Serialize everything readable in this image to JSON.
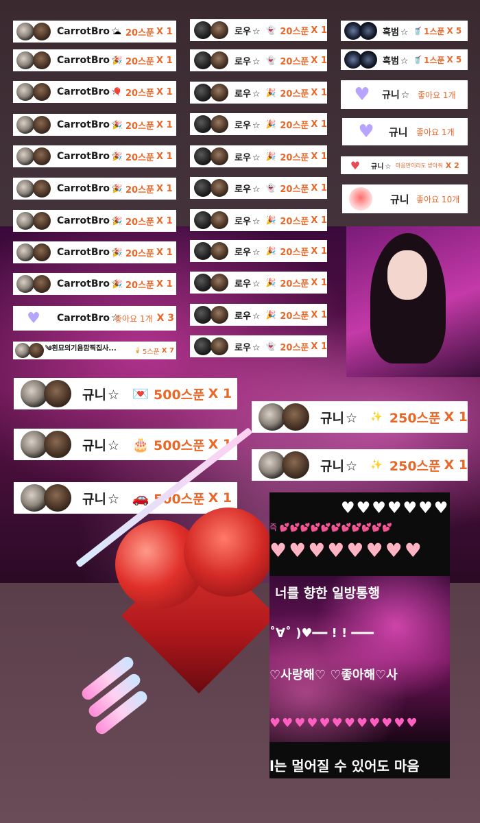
{
  "star": "☆",
  "carrot_cards": [
    {
      "name": "CarrotBro",
      "gift_icon": "cloud-icon",
      "gift_glyph": "☁",
      "amount": "20스푼",
      "multiplier": "X 1"
    },
    {
      "name": "CarrotBro",
      "gift_icon": "confetti-icon",
      "gift_glyph": "🎉",
      "amount": "20스푼",
      "multiplier": "X 1"
    },
    {
      "name": "CarrotBro",
      "gift_icon": "balloon-icon",
      "gift_glyph": "🎈",
      "amount": "20스푼",
      "multiplier": "X 1"
    },
    {
      "name": "CarrotBro",
      "gift_icon": "confetti-icon",
      "gift_glyph": "🎉",
      "amount": "20스푼",
      "multiplier": "X 1"
    },
    {
      "name": "CarrotBro",
      "gift_icon": "confetti-icon",
      "gift_glyph": "🎉",
      "amount": "20스푼",
      "multiplier": "X 1"
    },
    {
      "name": "CarrotBro",
      "gift_icon": "confetti-icon",
      "gift_glyph": "🎉",
      "amount": "20스푼",
      "multiplier": "X 1"
    },
    {
      "name": "CarrotBro",
      "gift_icon": "confetti-icon",
      "gift_glyph": "🎉",
      "amount": "20스푼",
      "multiplier": "X 1"
    },
    {
      "name": "CarrotBro",
      "gift_icon": "confetti-icon",
      "gift_glyph": "🎉",
      "amount": "20스푼",
      "multiplier": "X 1"
    },
    {
      "name": "CarrotBro",
      "gift_icon": "confetti-icon",
      "gift_glyph": "🎉",
      "amount": "20스푼",
      "multiplier": "X 1"
    }
  ],
  "carrot_like": {
    "name": "CarrotBro",
    "like_text": "좋아요 1개",
    "multiplier": "X 3"
  },
  "long_name_card": {
    "name": "༄흰묘의기욤깜찍집사...",
    "amount": "5스푼",
    "multiplier": "X 7"
  },
  "rowoo_cards": [
    {
      "name": "로우",
      "gift_icon": "ghost-icon",
      "gift_glyph": "👻",
      "amount": "20스푼",
      "multiplier": "X 1"
    },
    {
      "name": "로우",
      "gift_icon": "ghost-icon",
      "gift_glyph": "👻",
      "amount": "20스푼",
      "multiplier": "X 1"
    },
    {
      "name": "로우",
      "gift_icon": "confetti-icon",
      "gift_glyph": "🎉",
      "amount": "20스푼",
      "multiplier": "X 1"
    },
    {
      "name": "로우",
      "gift_icon": "confetti-icon",
      "gift_glyph": "🎉",
      "amount": "20스푼",
      "multiplier": "X 1"
    },
    {
      "name": "로우",
      "gift_icon": "confetti-icon",
      "gift_glyph": "🎉",
      "amount": "20스푼",
      "multiplier": "X 1"
    },
    {
      "name": "로우",
      "gift_icon": "ghost-icon",
      "gift_glyph": "👻",
      "amount": "20스푼",
      "multiplier": "X 1"
    },
    {
      "name": "로우",
      "gift_icon": "confetti-icon",
      "gift_glyph": "🎉",
      "amount": "20스푼",
      "multiplier": "X 1"
    },
    {
      "name": "로우",
      "gift_icon": "confetti-icon",
      "gift_glyph": "🎉",
      "amount": "20스푼",
      "multiplier": "X 1"
    },
    {
      "name": "로우",
      "gift_icon": "confetti-icon",
      "gift_glyph": "🎉",
      "amount": "20스푼",
      "multiplier": "X 1"
    },
    {
      "name": "로우",
      "gift_icon": "confetti-icon",
      "gift_glyph": "🎉",
      "amount": "20스푼",
      "multiplier": "X 1"
    },
    {
      "name": "로우",
      "gift_icon": "ghost-icon",
      "gift_glyph": "👻",
      "amount": "20스푼",
      "multiplier": "X 1"
    }
  ],
  "heukbeom_cards": [
    {
      "name": "흑범",
      "gift_icon": "drink-icon",
      "gift_glyph": "🥤",
      "amount": "1스푼",
      "multiplier": "X 5"
    },
    {
      "name": "흑범",
      "gift_icon": "drink-icon",
      "gift_glyph": "🥤",
      "amount": "1스푼",
      "multiplier": "X 5"
    }
  ],
  "gyuni_likes": [
    {
      "name": "규니",
      "like_text": "좋아요 1개"
    },
    {
      "name": "규니",
      "like_text": "좋아요 1개"
    }
  ],
  "gyuni_heart_msg": {
    "name": "규니",
    "message": "마음만이라도 받아줘",
    "multiplier": "X 2"
  },
  "gyuni_like10": {
    "name": "규니",
    "like_text": "좋아요 10개"
  },
  "gyuni_500": [
    {
      "name": "규니",
      "gift_icon": "love-letter-icon",
      "gift_glyph": "💌",
      "amount": "500스푼",
      "multiplier": "X 1"
    },
    {
      "name": "규니",
      "gift_icon": "cake-icon",
      "gift_glyph": "🎂",
      "amount": "500스푼",
      "multiplier": "X 1"
    },
    {
      "name": "규니",
      "gift_icon": "car-icon",
      "gift_glyph": "🚗",
      "amount": "500스푼",
      "multiplier": "X 1"
    }
  ],
  "gyuni_250": [
    {
      "name": "규니",
      "gift_icon": "sparkle-icon",
      "gift_glyph": "✨",
      "amount": "250스푼",
      "multiplier": "X 1"
    },
    {
      "name": "규니",
      "gift_icon": "sparkle-icon",
      "gift_glyph": "✨",
      "amount": "250스푼",
      "multiplier": "X 1"
    }
  ],
  "strip": {
    "hearts_top": "♥♥♥♥♥♥♥",
    "hearts_small": "즉 💕💕💕💕💕💕💕💕💕💕💕",
    "hearts_pink": "♥♥♥♥♥♥♥♥",
    "line1": "너를 향한 일방통행",
    "line2": "˚∀˚ )♥━━ ! ! ━━━",
    "line3": "♡사랑해♡ ♡좋아해♡사",
    "hearts_row": "♥♥♥♥♥♥♥♥♥♥♥♥",
    "line4": "l는 멀어질 수 있어도 마음"
  },
  "colors": {
    "amount": "#e8682a",
    "card_bg": "#ffffff",
    "accent_pink": "#ff5fc8"
  }
}
